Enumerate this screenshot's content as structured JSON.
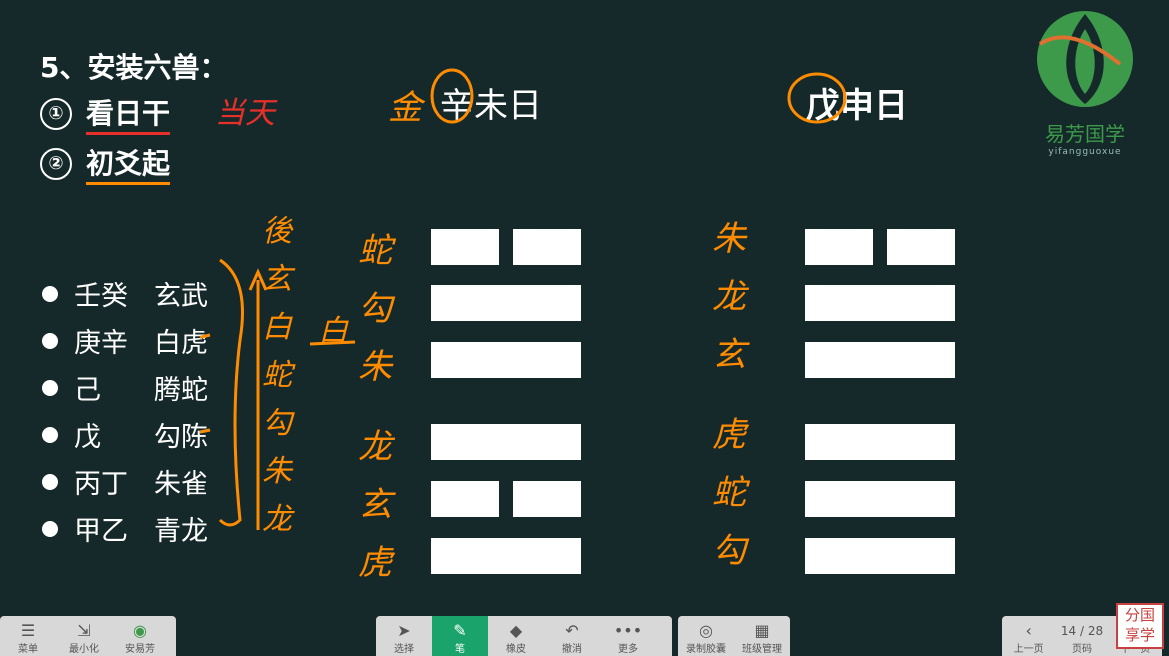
{
  "heading": "5、安装六兽：",
  "steps": [
    {
      "num": "①",
      "text": "看日干"
    },
    {
      "num": "②",
      "text": "初爻起"
    }
  ],
  "annotation_red": "当天",
  "beasts": [
    {
      "stem": "壬癸",
      "beast": "玄武"
    },
    {
      "stem": "庚辛",
      "beast": "白虎"
    },
    {
      "stem": "己",
      "beast": "腾蛇"
    },
    {
      "stem": "戊",
      "beast": "勾陈"
    },
    {
      "stem": "丙丁",
      "beast": "朱雀"
    },
    {
      "stem": "甲乙",
      "beast": "青龙"
    }
  ],
  "hex_left": {
    "prefix_hand": "金",
    "title": "辛未日",
    "lines": [
      "broken",
      "solid",
      "solid",
      "solid",
      "broken",
      "solid"
    ],
    "beasts_hand": [
      "蛇",
      "勾",
      "朱",
      "龙",
      "玄",
      "虎"
    ]
  },
  "hex_right": {
    "title": "戊申日",
    "lines": [
      "broken",
      "solid",
      "solid",
      "solid",
      "solid",
      "solid"
    ],
    "beasts_hand": [
      "朱",
      "龙",
      "玄",
      "虎",
      "蛇",
      "勾"
    ]
  },
  "vertical_hand": [
    "後",
    "玄",
    "白",
    "蛇",
    "勾",
    "朱",
    "龙"
  ],
  "side_hand": "白",
  "logo": {
    "cn": "易芳国学",
    "en": "yifangguoxue"
  },
  "left_toolbar": [
    {
      "icon": "menu-icon",
      "glyph": "☰",
      "label": "菜单"
    },
    {
      "icon": "minimize-icon",
      "glyph": "⇲",
      "label": "最小化"
    },
    {
      "icon": "app-icon",
      "glyph": "◉",
      "label": "安易芳"
    }
  ],
  "mid_toolbar": [
    {
      "icon": "cursor-icon",
      "glyph": "➤",
      "label": "选择"
    },
    {
      "icon": "pen-icon",
      "glyph": "✎",
      "label": "笔"
    },
    {
      "icon": "eraser-icon",
      "glyph": "◆",
      "label": "橡皮"
    },
    {
      "icon": "undo-icon",
      "glyph": "↶",
      "label": "撤消"
    },
    {
      "icon": "more-icon",
      "glyph": "•••",
      "label": "更多"
    }
  ],
  "rec_toolbar": [
    {
      "icon": "record-icon",
      "glyph": "◎",
      "label": "录制胶囊"
    },
    {
      "icon": "class-icon",
      "glyph": "▦",
      "label": "班级管理"
    }
  ],
  "pager": {
    "prev": "上一页",
    "page": "14 / 28",
    "page_label": "页码",
    "next": "下一页"
  },
  "stamp": "分国享学"
}
